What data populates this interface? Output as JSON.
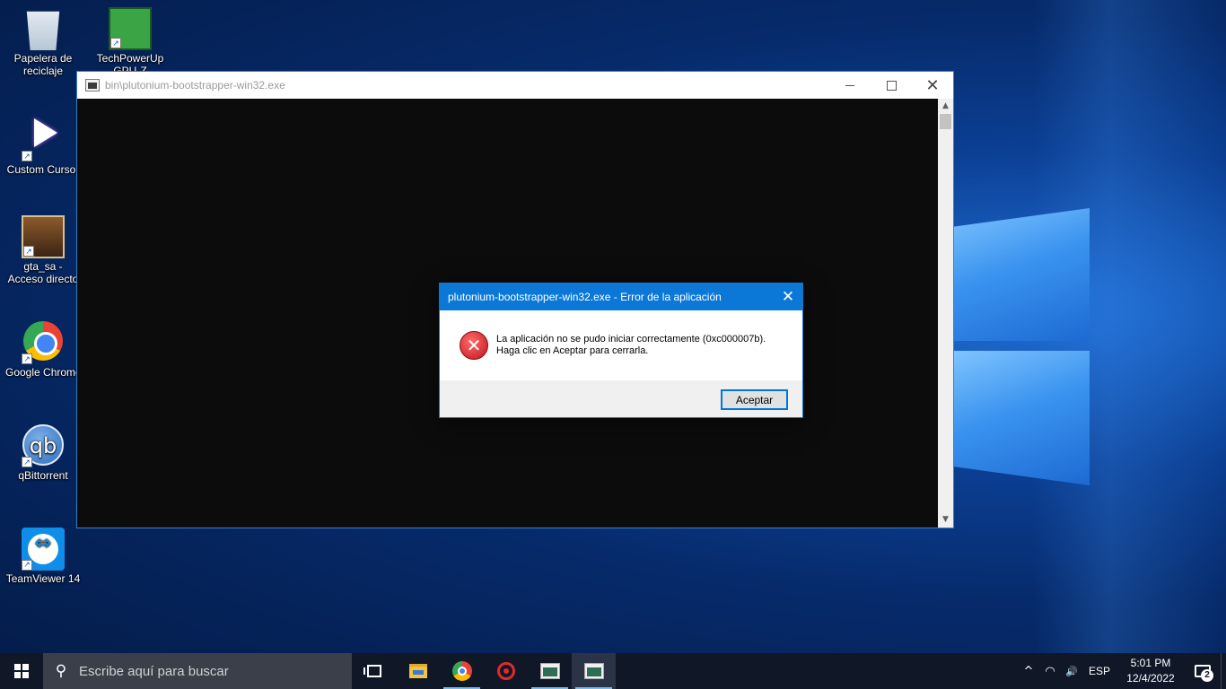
{
  "desktop": {
    "icons": [
      {
        "label": "Papelera de reciclaje",
        "icon": "recycle-bin-icon"
      },
      {
        "label": "TechPowerUp GPU-Z",
        "icon": "gpu-z-icon"
      },
      {
        "label": "Custom Cursor",
        "icon": "cursor-icon"
      },
      {
        "label": "gta_sa - Acceso directo",
        "icon": "gta-sa-icon"
      },
      {
        "label": "Google Chrome",
        "icon": "chrome-icon"
      },
      {
        "label": "qBittorrent",
        "icon": "qbittorrent-icon",
        "glyph": "qb"
      },
      {
        "label": "TeamViewer 14",
        "icon": "teamviewer-icon",
        "glyph": "⇔"
      }
    ],
    "shortcut_glyph": "↗"
  },
  "console_window": {
    "title": "bin\\plutonium-bootstrapper-win32.exe",
    "close_glyph": "✕",
    "scroll_up": "▲",
    "scroll_down": "▼"
  },
  "dialog": {
    "title": "plutonium-bootstrapper-win32.exe - Error de la aplicación",
    "close_glyph": "✕",
    "error_glyph": "✕",
    "message_line1": "La aplicación no se pudo iniciar correctamente (0xc000007b).",
    "message_line2": "Haga clic en Aceptar para cerrarla.",
    "ok_label": "Aceptar"
  },
  "taskbar": {
    "search_placeholder": "Escribe aquí para buscar",
    "search_glyph": "⚲",
    "tray": {
      "chevron": "^",
      "network": "◠",
      "volume": "🔊",
      "language": "ESP",
      "time": "5:01 PM",
      "date": "12/4/2022",
      "notification_count": "2"
    }
  },
  "colors": {
    "dialog_titlebar": "#0b78d7",
    "console_bg": "#0c0c0c",
    "taskbar_bg": "#101828",
    "accent": "#0078d7"
  }
}
